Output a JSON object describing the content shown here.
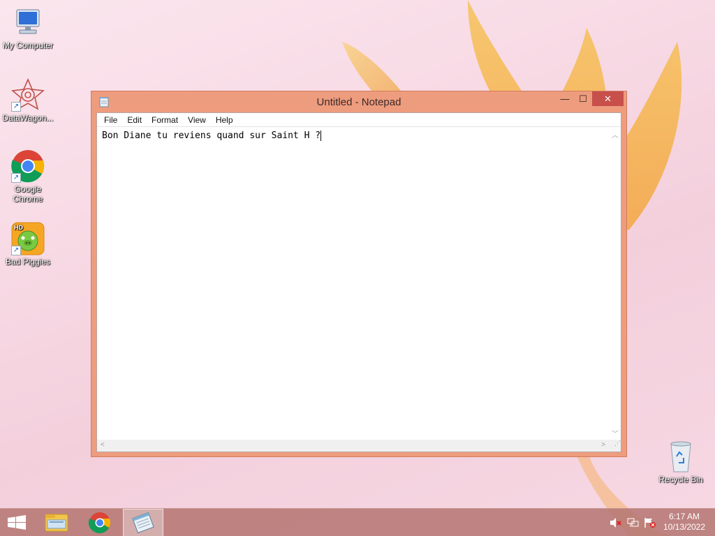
{
  "desktop": {
    "icons": [
      {
        "label": "My Computer",
        "icon": "computer-icon"
      },
      {
        "label": "DataWagon...",
        "icon": "datawagon-icon"
      },
      {
        "label": "Google Chrome",
        "icon": "chrome-icon"
      },
      {
        "label": "Bad Piggies",
        "icon": "bad-piggies-icon"
      },
      {
        "label": "Recycle Bin",
        "icon": "recycle-bin-icon"
      }
    ]
  },
  "notepad": {
    "title": "Untitled - Notepad",
    "menu": [
      "File",
      "Edit",
      "Format",
      "View",
      "Help"
    ],
    "content": "Bon Diane tu reviens quand sur Saint H ?",
    "controls": {
      "minimize": "—",
      "maximize": "☐",
      "close": "✕"
    }
  },
  "taskbar": {
    "items": [
      "start-icon",
      "file-explorer-icon",
      "chrome-icon",
      "notepad-icon"
    ],
    "tray": [
      "volume-muted-icon",
      "network-icon",
      "action-center-icon"
    ],
    "time": "6:17 AM",
    "date": "10/13/2022"
  },
  "colors": {
    "window_frame": "#ee9c7e",
    "close_button": "#c7504b",
    "taskbar": "#b67874"
  }
}
